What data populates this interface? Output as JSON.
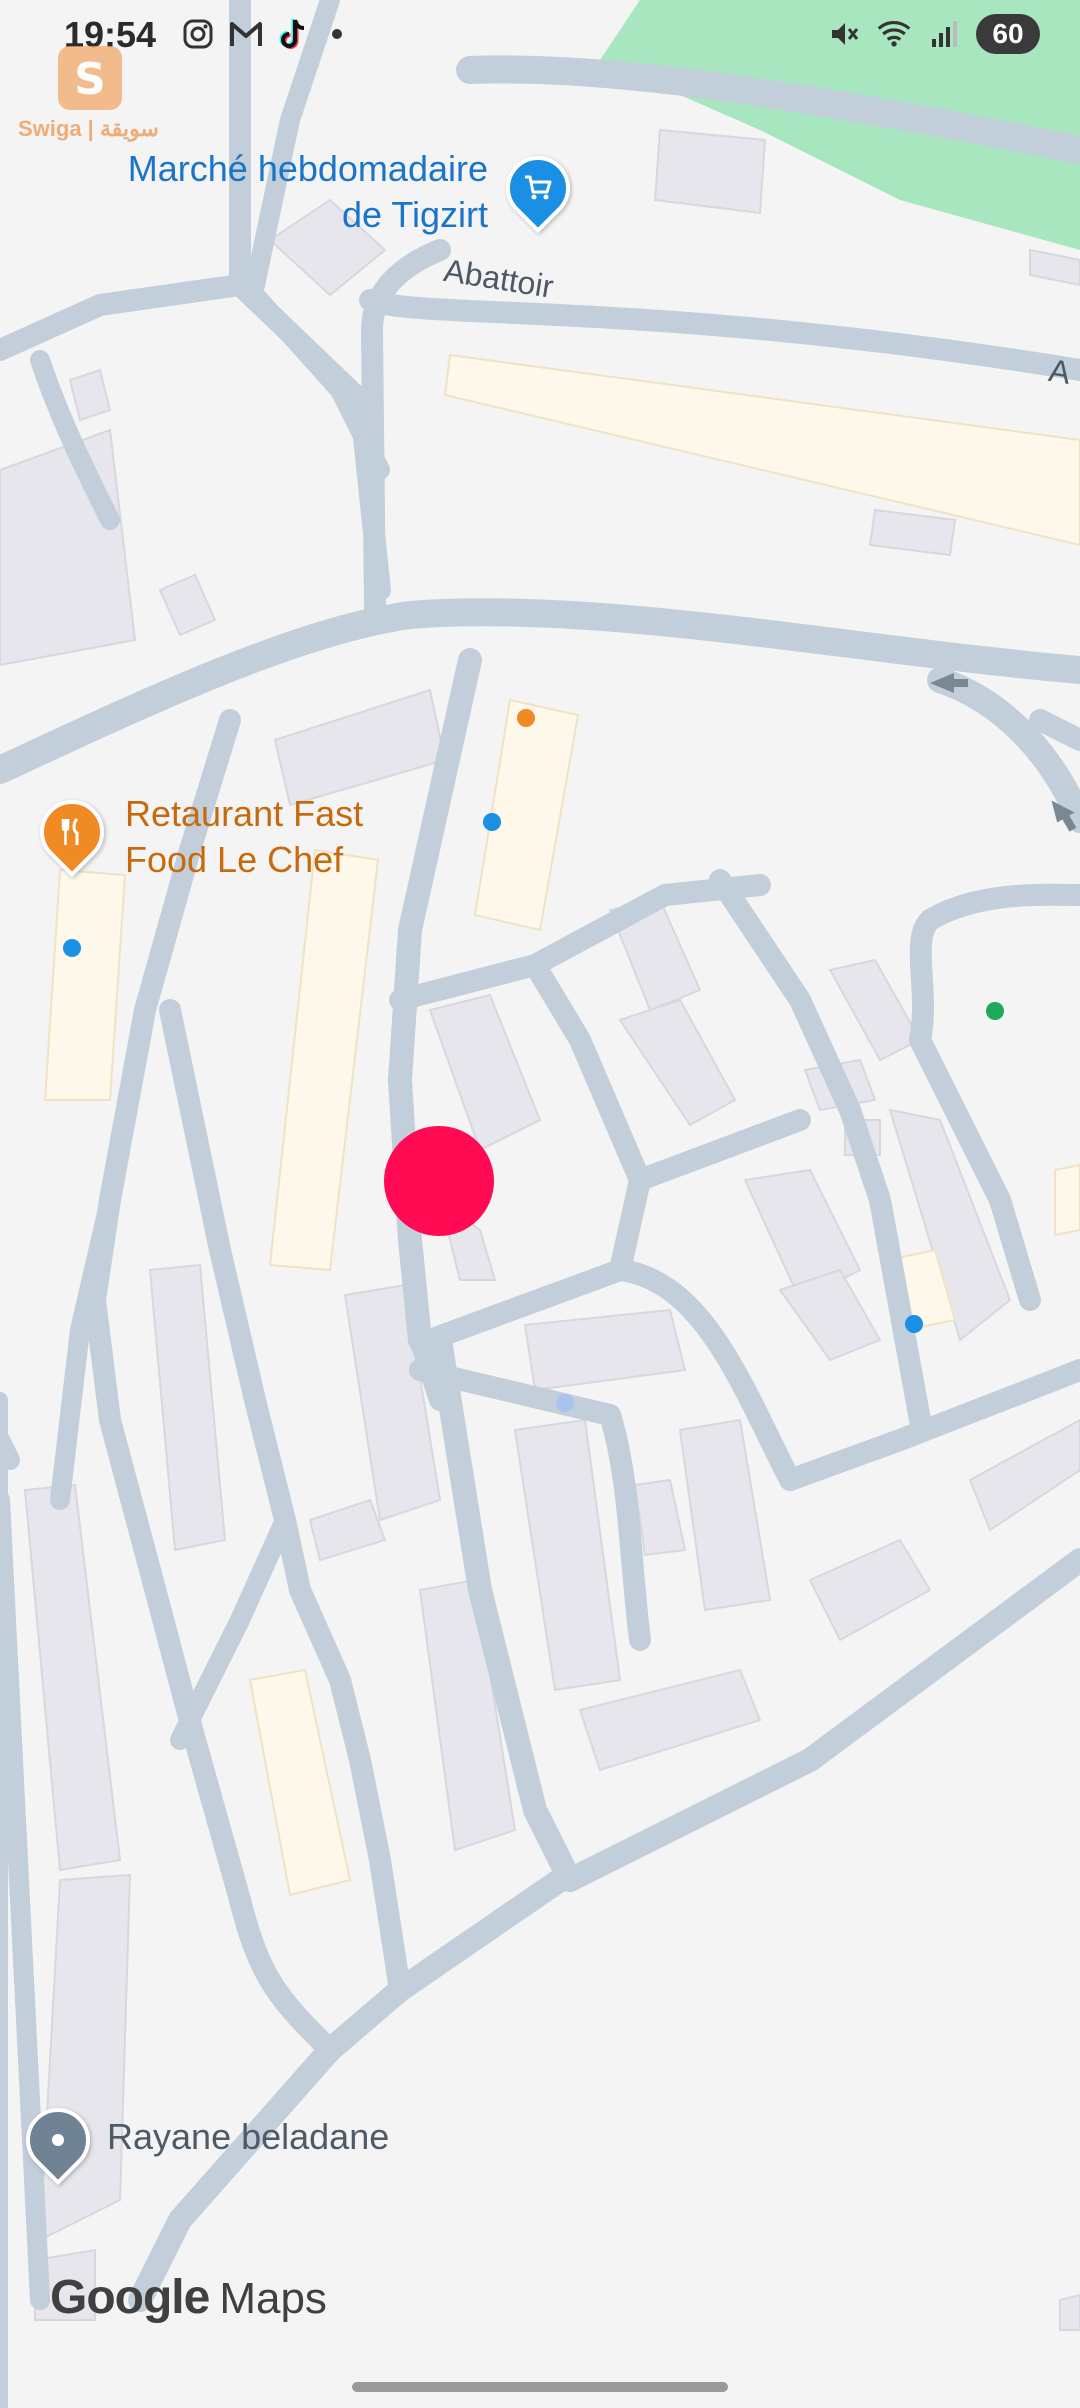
{
  "status_bar": {
    "time": "19:54",
    "battery": "60",
    "left_icons": [
      "instagram-icon",
      "gmail-icon",
      "tiktok-icon"
    ],
    "right_icons": [
      "mute-icon",
      "wifi-icon",
      "signal-icon"
    ]
  },
  "watermark": {
    "text": "Swiga | سويقة",
    "logo_letter": "S"
  },
  "map": {
    "pois": [
      {
        "line1": "Marché hebdomadaire",
        "line2": "de Tigzirt",
        "icon": "shopping-cart-icon",
        "color": "#1a8fe3"
      },
      {
        "line1": "Retaurant Fast",
        "line2": "Food Le Chef",
        "icon": "restaurant-icon",
        "color": "#f08a24"
      },
      {
        "line1": "Rayane beladane",
        "line2": "",
        "icon": "location-pin-icon",
        "color": "#6f8394"
      }
    ],
    "streets": [
      {
        "name": "Abattoir"
      },
      {
        "name": "A"
      }
    ],
    "current_location_color": "#ff0a53"
  },
  "branding": {
    "google": "Google",
    "maps": "Maps"
  }
}
